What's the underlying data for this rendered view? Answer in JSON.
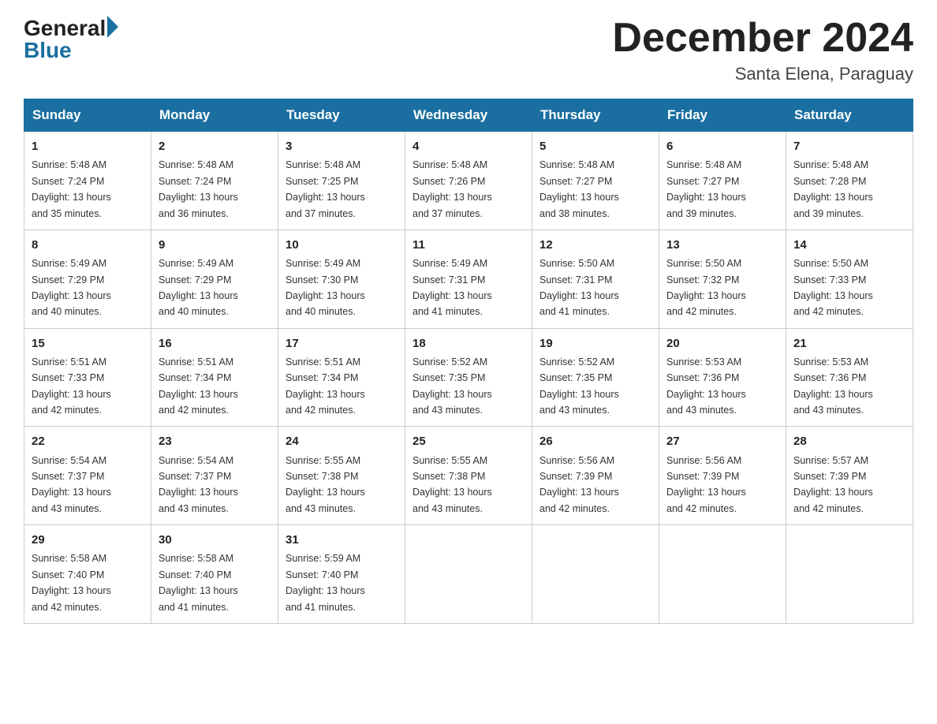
{
  "logo": {
    "general": "General",
    "blue": "Blue"
  },
  "title": {
    "month_year": "December 2024",
    "location": "Santa Elena, Paraguay"
  },
  "headers": [
    "Sunday",
    "Monday",
    "Tuesday",
    "Wednesday",
    "Thursday",
    "Friday",
    "Saturday"
  ],
  "weeks": [
    [
      {
        "day": "1",
        "sunrise": "5:48 AM",
        "sunset": "7:24 PM",
        "daylight": "13 hours and 35 minutes."
      },
      {
        "day": "2",
        "sunrise": "5:48 AM",
        "sunset": "7:24 PM",
        "daylight": "13 hours and 36 minutes."
      },
      {
        "day": "3",
        "sunrise": "5:48 AM",
        "sunset": "7:25 PM",
        "daylight": "13 hours and 37 minutes."
      },
      {
        "day": "4",
        "sunrise": "5:48 AM",
        "sunset": "7:26 PM",
        "daylight": "13 hours and 37 minutes."
      },
      {
        "day": "5",
        "sunrise": "5:48 AM",
        "sunset": "7:27 PM",
        "daylight": "13 hours and 38 minutes."
      },
      {
        "day": "6",
        "sunrise": "5:48 AM",
        "sunset": "7:27 PM",
        "daylight": "13 hours and 39 minutes."
      },
      {
        "day": "7",
        "sunrise": "5:48 AM",
        "sunset": "7:28 PM",
        "daylight": "13 hours and 39 minutes."
      }
    ],
    [
      {
        "day": "8",
        "sunrise": "5:49 AM",
        "sunset": "7:29 PM",
        "daylight": "13 hours and 40 minutes."
      },
      {
        "day": "9",
        "sunrise": "5:49 AM",
        "sunset": "7:29 PM",
        "daylight": "13 hours and 40 minutes."
      },
      {
        "day": "10",
        "sunrise": "5:49 AM",
        "sunset": "7:30 PM",
        "daylight": "13 hours and 40 minutes."
      },
      {
        "day": "11",
        "sunrise": "5:49 AM",
        "sunset": "7:31 PM",
        "daylight": "13 hours and 41 minutes."
      },
      {
        "day": "12",
        "sunrise": "5:50 AM",
        "sunset": "7:31 PM",
        "daylight": "13 hours and 41 minutes."
      },
      {
        "day": "13",
        "sunrise": "5:50 AM",
        "sunset": "7:32 PM",
        "daylight": "13 hours and 42 minutes."
      },
      {
        "day": "14",
        "sunrise": "5:50 AM",
        "sunset": "7:33 PM",
        "daylight": "13 hours and 42 minutes."
      }
    ],
    [
      {
        "day": "15",
        "sunrise": "5:51 AM",
        "sunset": "7:33 PM",
        "daylight": "13 hours and 42 minutes."
      },
      {
        "day": "16",
        "sunrise": "5:51 AM",
        "sunset": "7:34 PM",
        "daylight": "13 hours and 42 minutes."
      },
      {
        "day": "17",
        "sunrise": "5:51 AM",
        "sunset": "7:34 PM",
        "daylight": "13 hours and 42 minutes."
      },
      {
        "day": "18",
        "sunrise": "5:52 AM",
        "sunset": "7:35 PM",
        "daylight": "13 hours and 43 minutes."
      },
      {
        "day": "19",
        "sunrise": "5:52 AM",
        "sunset": "7:35 PM",
        "daylight": "13 hours and 43 minutes."
      },
      {
        "day": "20",
        "sunrise": "5:53 AM",
        "sunset": "7:36 PM",
        "daylight": "13 hours and 43 minutes."
      },
      {
        "day": "21",
        "sunrise": "5:53 AM",
        "sunset": "7:36 PM",
        "daylight": "13 hours and 43 minutes."
      }
    ],
    [
      {
        "day": "22",
        "sunrise": "5:54 AM",
        "sunset": "7:37 PM",
        "daylight": "13 hours and 43 minutes."
      },
      {
        "day": "23",
        "sunrise": "5:54 AM",
        "sunset": "7:37 PM",
        "daylight": "13 hours and 43 minutes."
      },
      {
        "day": "24",
        "sunrise": "5:55 AM",
        "sunset": "7:38 PM",
        "daylight": "13 hours and 43 minutes."
      },
      {
        "day": "25",
        "sunrise": "5:55 AM",
        "sunset": "7:38 PM",
        "daylight": "13 hours and 43 minutes."
      },
      {
        "day": "26",
        "sunrise": "5:56 AM",
        "sunset": "7:39 PM",
        "daylight": "13 hours and 42 minutes."
      },
      {
        "day": "27",
        "sunrise": "5:56 AM",
        "sunset": "7:39 PM",
        "daylight": "13 hours and 42 minutes."
      },
      {
        "day": "28",
        "sunrise": "5:57 AM",
        "sunset": "7:39 PM",
        "daylight": "13 hours and 42 minutes."
      }
    ],
    [
      {
        "day": "29",
        "sunrise": "5:58 AM",
        "sunset": "7:40 PM",
        "daylight": "13 hours and 42 minutes."
      },
      {
        "day": "30",
        "sunrise": "5:58 AM",
        "sunset": "7:40 PM",
        "daylight": "13 hours and 41 minutes."
      },
      {
        "day": "31",
        "sunrise": "5:59 AM",
        "sunset": "7:40 PM",
        "daylight": "13 hours and 41 minutes."
      },
      null,
      null,
      null,
      null
    ]
  ],
  "labels": {
    "sunrise": "Sunrise:",
    "sunset": "Sunset:",
    "daylight": "Daylight:"
  }
}
